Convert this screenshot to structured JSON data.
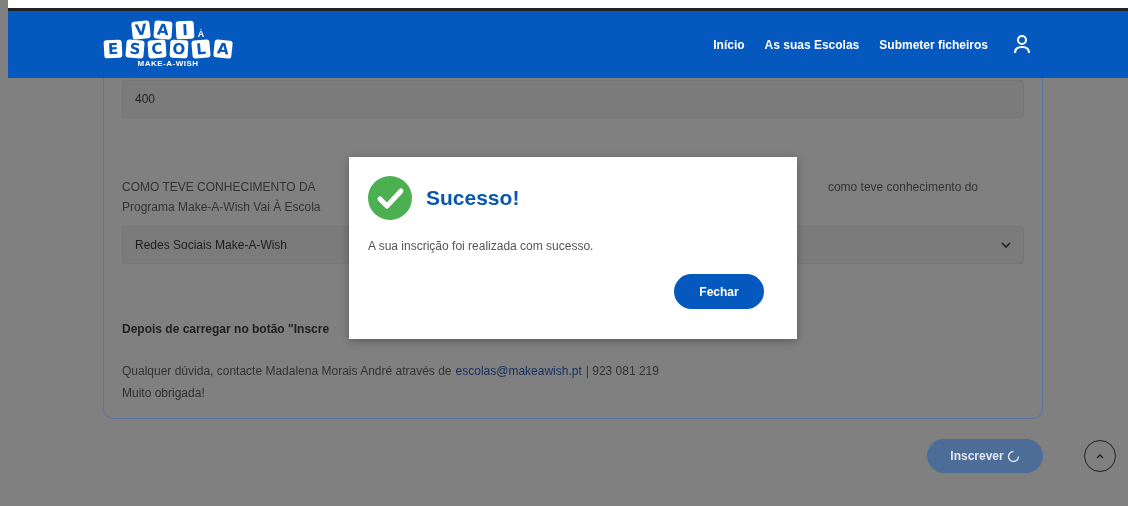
{
  "header": {
    "logo": {
      "top": [
        "V",
        "A",
        "I"
      ],
      "accent": "À",
      "bottom": [
        "E",
        "S",
        "C",
        "O",
        "L",
        "A"
      ],
      "tagline": "MAKE-A-WISH"
    },
    "nav": [
      {
        "label": "Início"
      },
      {
        "label": "As suas Escolas"
      },
      {
        "label": "Submeter ficheiros"
      }
    ]
  },
  "form": {
    "quantity_field": {
      "value": "400"
    },
    "source_question": {
      "left_part": "COMO TEVE CONHECIMENTO DA",
      "right_part": "como teve conhecimento do",
      "second_line": "Programa Make-A-Wish Vai À Escola"
    },
    "source_select": {
      "value": "Redes Sociais Make-A-Wish"
    },
    "note": "Depois de carregar no botão \"Inscre",
    "contact": {
      "text": "Qualquer dúvida, contacte Madalena Morais André através de",
      "email": "escolas@makeawish.pt",
      "phone": "| 923 081 219"
    },
    "thanks": "Muito obrigada!",
    "submit": {
      "label": "Inscrever",
      "loading": true,
      "disabled": true
    }
  },
  "modal": {
    "title": "Sucesso!",
    "message": "A sua inscrição foi realizada com sucesso.",
    "button": "Fechar"
  }
}
